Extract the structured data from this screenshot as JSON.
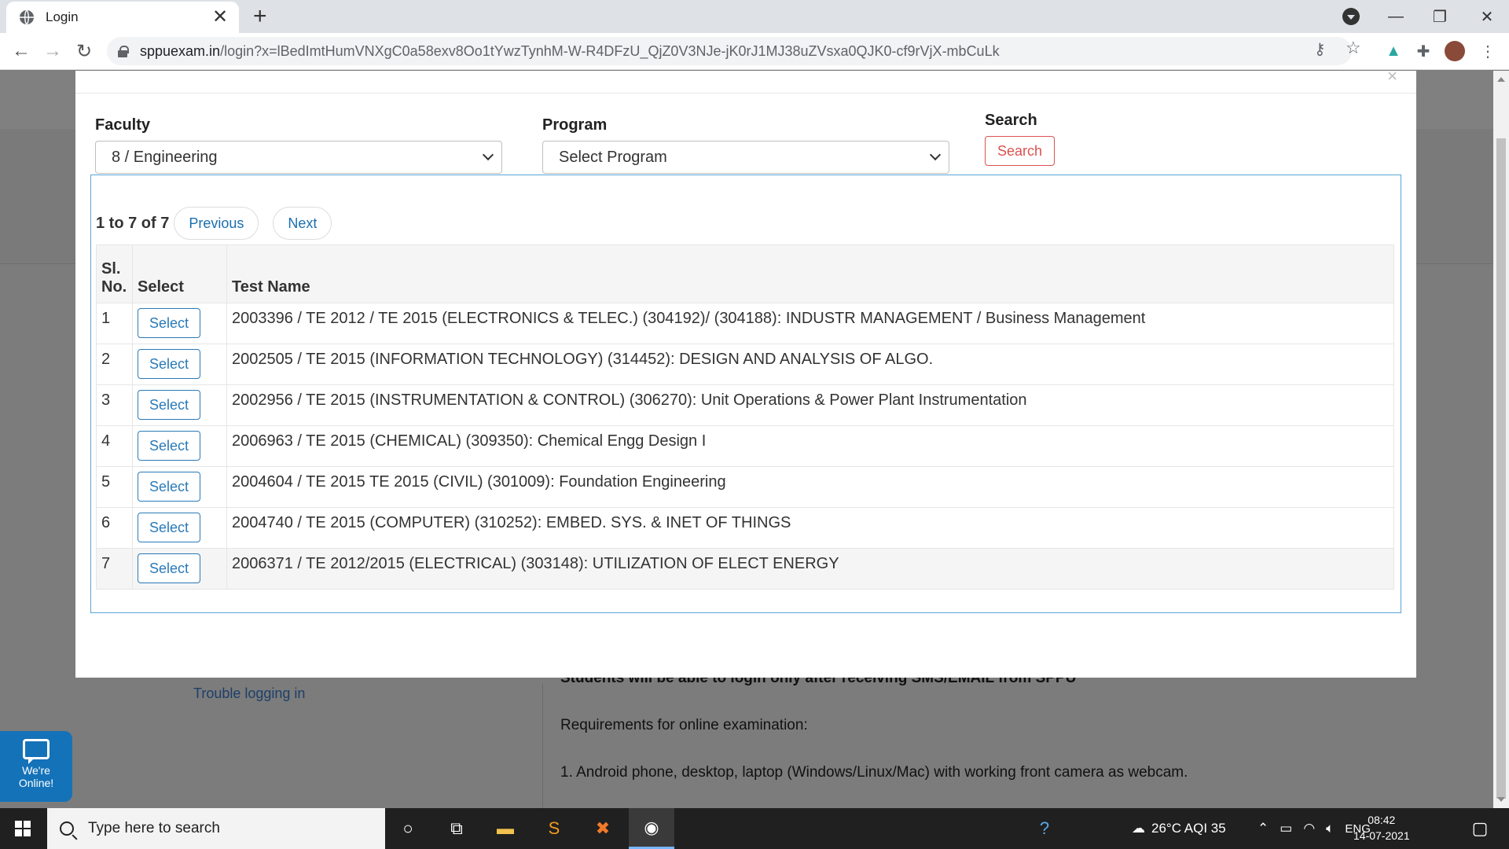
{
  "browser": {
    "tab_title": "Login",
    "url_host": "sppuexam.in",
    "url_path": "/login?x=lBedImtHumVNXgC0a58exv8Oo1tYwzTynhM-W-R4DFzU_QjZ0V3NJe-jK0rJ1MJ38uZVsxa0QJK0-cf9rVjX-mbCuLk",
    "tab_close": "✕",
    "new_tab": "+"
  },
  "modal": {
    "faculty_label": "Faculty",
    "faculty_value": "8 / Engineering",
    "program_label": "Program",
    "program_value": "Select Program",
    "search_label": "Search",
    "search_button": "Search",
    "pager": {
      "count": "1 to 7 of 7",
      "previous": "Previous",
      "next": "Next"
    },
    "table": {
      "headers": [
        "Sl. No.",
        "Select",
        "Test Name"
      ],
      "select_label": "Select",
      "rows": [
        {
          "no": "1",
          "name": "2003396 / TE 2012 / TE 2015 (ELECTRONICS & TELEC.) (304192)/ (304188): INDUSTR MANAGEMENT / Business Management"
        },
        {
          "no": "2",
          "name": "2002505 / TE 2015 (INFORMATION TECHNOLOGY) (314452): DESIGN AND ANALYSIS OF ALGO."
        },
        {
          "no": "3",
          "name": "2002956 / TE 2015 (INSTRUMENTATION & CONTROL) (306270): Unit Operations & Power Plant Instrumentation"
        },
        {
          "no": "4",
          "name": "2006963 / TE 2015 (CHEMICAL) (309350): Chemical Engg Design I"
        },
        {
          "no": "5",
          "name": "2004604 / TE 2015 TE 2015 (CIVIL) (301009): Foundation Engineering"
        },
        {
          "no": "6",
          "name": "2004740 / TE 2015 (COMPUTER) (310252): EMBED. SYS. & INET OF THINGS"
        },
        {
          "no": "7",
          "name": "2006371 / TE 2012/2015 (ELECTRICAL) (303148): UTILIZATION OF ELECT ENERGY"
        }
      ]
    }
  },
  "background": {
    "trouble_link": "Trouble logging in",
    "bold_notice": "Students will be able to login only after receiving SMS/EMAIL from SPPU",
    "requirements": "Requirements for online examination:",
    "requirement_1": "1. Android phone, desktop, laptop (Windows/Linux/Mac) with working front camera as webcam.",
    "chat_line1": "We're",
    "chat_line2": "Online!"
  },
  "taskbar": {
    "search_placeholder": "Type here to search",
    "weather": "26°C AQI 35",
    "language": "ENG",
    "time": "08:42",
    "date": "14-07-2021"
  }
}
